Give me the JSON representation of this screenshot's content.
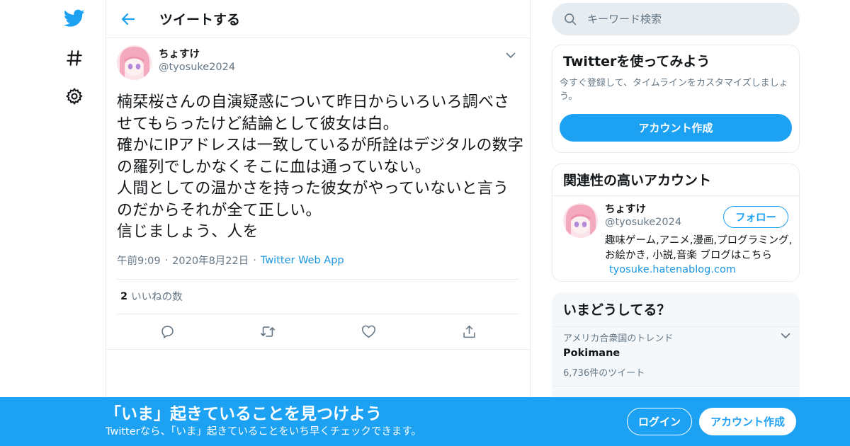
{
  "header": {
    "title": "ツイートする"
  },
  "tweet": {
    "author_name": "ちょすけ",
    "author_handle": "@tyosuke2024",
    "text": "楠栞桜さんの自演疑惑について昨日からいろいろ調べさせてもらったけど結論として彼女は白。\n確かにIPアドレスは一致しているが所詮はデジタルの数字の羅列でしかなくそこに血は通っていない。\n人間としての温かさを持った彼女がやっていないと言うのだからそれが全て正しい。\n信じましょう、人を",
    "time": "午前9:09",
    "date": "2020年8月22日",
    "source": "Twitter Web App",
    "likes_count": "2",
    "likes_label": "いいねの数"
  },
  "search": {
    "placeholder": "キーワード検索"
  },
  "signup_card": {
    "title": "Twitterを使ってみよう",
    "description": "今すぐ登録して、タイムラインをカスタマイズしましょう。",
    "button": "アカウント作成"
  },
  "related_card": {
    "title": "関連性の高いアカウント",
    "name": "ちょすけ",
    "handle": "@tyosuke2024",
    "follow_label": "フォロー",
    "bio": "趣味ゲーム,アニメ,漫画,プログラミング,お絵かき, 小説,音楽 ブログはこちら",
    "bio_link": "tyosuke.hatenablog.com"
  },
  "trends_card": {
    "title": "いまどうしてる？",
    "items": [
      {
        "context": "アメリカ合衆国のトレンド",
        "name": "Pokimane",
        "count": "6,736件のツイート"
      }
    ]
  },
  "bottom_bar": {
    "headline": "「いま」起きていることを見つけよう",
    "subtext": "Twitterなら、「いま」起きていることをいち早くチェックできます。",
    "login": "ログイン",
    "signup": "アカウント作成"
  },
  "colors": {
    "accent": "#1da1f2",
    "link": "#1b95e0",
    "secondary_text": "#657786",
    "border": "#e6ecf0"
  },
  "icons": [
    "twitter-logo-icon",
    "hashtag-icon",
    "gear-icon",
    "back-arrow-icon",
    "chevron-down-icon",
    "search-icon",
    "reply-icon",
    "retweet-icon",
    "heart-icon",
    "share-icon"
  ]
}
